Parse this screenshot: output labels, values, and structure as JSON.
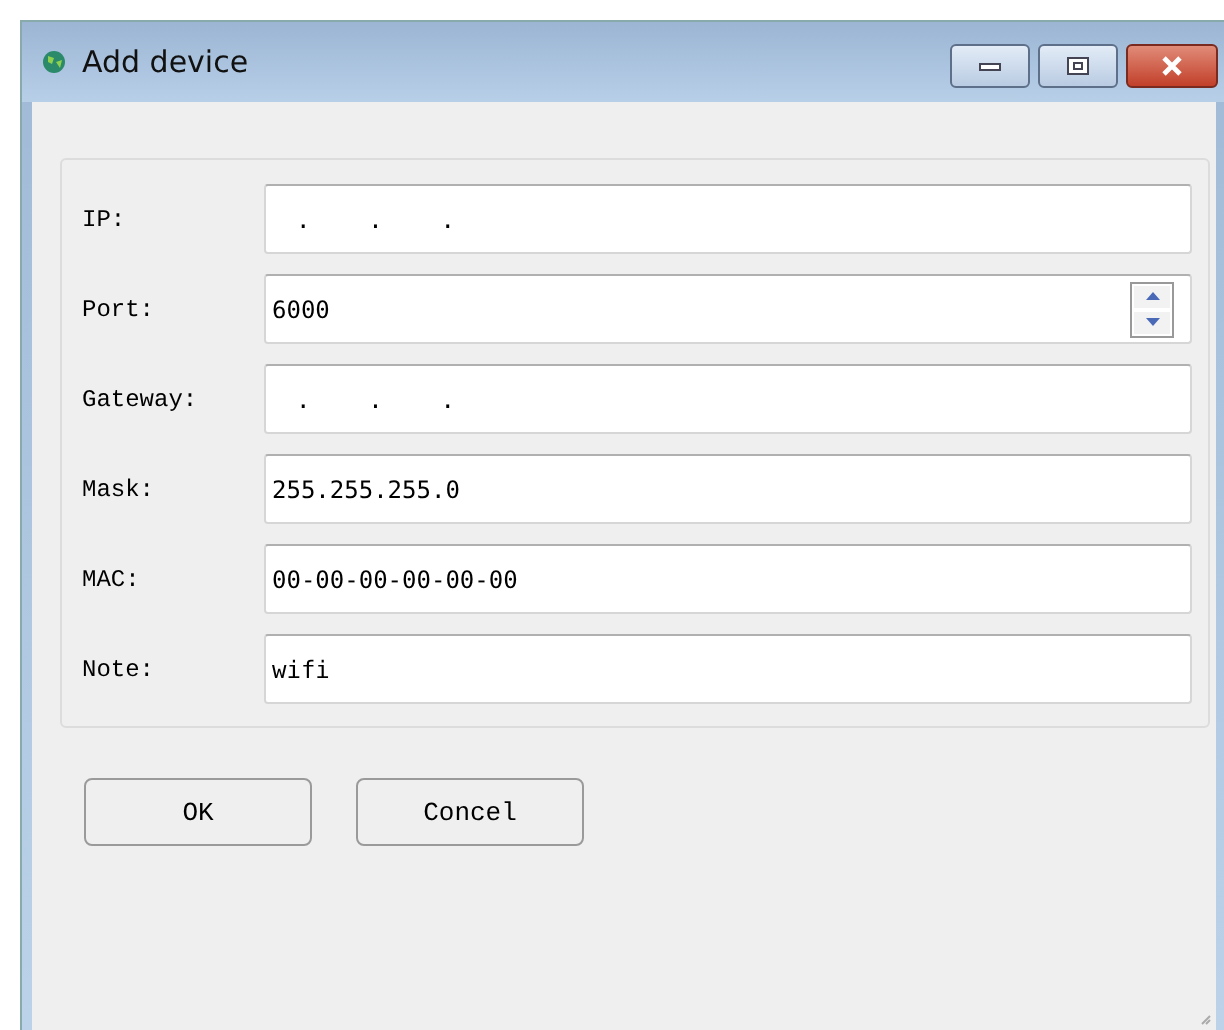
{
  "window": {
    "title": "Add device"
  },
  "fields": [
    {
      "label": "IP:",
      "kind": "ip",
      "value": ".    .    ."
    },
    {
      "label": "Port:",
      "kind": "spin",
      "value": "6000"
    },
    {
      "label": "Gateway:",
      "kind": "ip",
      "value": ".    .    ."
    },
    {
      "label": "Mask:",
      "kind": "text",
      "value": "255.255.255.0"
    },
    {
      "label": "MAC:",
      "kind": "text",
      "value": "00-00-00-00-00-00"
    },
    {
      "label": "Note:",
      "kind": "text",
      "value": "wifi"
    }
  ],
  "buttons": [
    "OK",
    "Concel"
  ]
}
